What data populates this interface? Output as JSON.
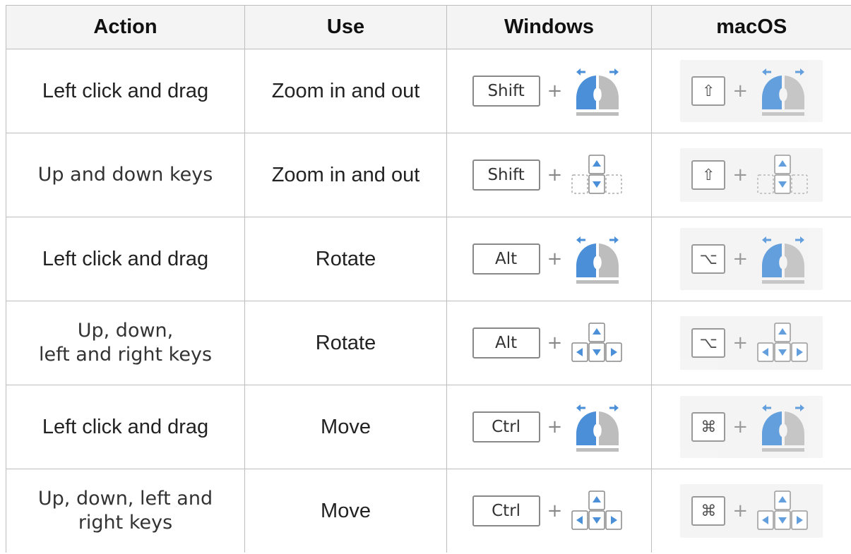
{
  "headers": {
    "action": "Action",
    "use": "Use",
    "windows": "Windows",
    "macos": "macOS"
  },
  "plus": "+",
  "rows": [
    {
      "action": "Left click and drag",
      "use": "Zoom in and out",
      "win_key": "Shift",
      "mac_key": "⇧",
      "gesture": "mouse-drag"
    },
    {
      "action": "Up and down keys",
      "use": "Zoom in and out",
      "win_key": "Shift",
      "mac_key": "⇧",
      "gesture": "up-down-keys"
    },
    {
      "action": "Left click and drag",
      "use": "Rotate",
      "win_key": "Alt",
      "mac_key": "⌥",
      "gesture": "mouse-drag"
    },
    {
      "action_line1": "Up, down,",
      "action_line2": "left and right keys",
      "use": "Rotate",
      "win_key": "Alt",
      "mac_key": "⌥",
      "gesture": "arrow-keys"
    },
    {
      "action": "Left click and drag",
      "use": "Move",
      "win_key": "Ctrl",
      "mac_key": "⌘",
      "gesture": "mouse-drag"
    },
    {
      "action_line1": "Up, down, left and",
      "action_line2": "right keys",
      "use": "Move",
      "win_key": "Ctrl",
      "mac_key": "⌘",
      "gesture": "arrow-keys"
    }
  ],
  "colors": {
    "accent_blue": "#4a8fd8",
    "mouse_grey": "#b9b9b9",
    "border": "#bdbdbd"
  }
}
